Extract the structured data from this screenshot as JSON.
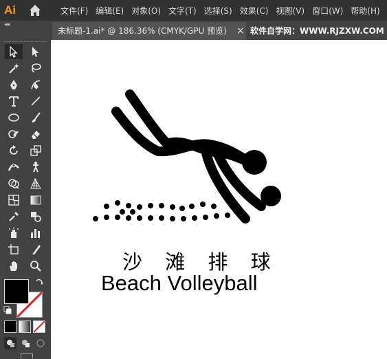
{
  "app": {
    "logo": "Ai"
  },
  "menu": [
    "文件(F)",
    "编辑(E)",
    "对象(O)",
    "文字(T)",
    "选择(S)",
    "效果(C)",
    "视图(V)",
    "窗口(W)",
    "帮助(H)"
  ],
  "tabs": {
    "collapse": "◂◂",
    "active": "未标题-1.ai* @ 186.36% (CMYK/GPU 预览)",
    "close": "×",
    "other": "软件自学网：WWW.RJZXW.COM"
  },
  "tools": [
    "selection-tool",
    "direct-selection-tool",
    "magic-wand-tool",
    "lasso-tool",
    "pen-tool",
    "curvature-tool",
    "type-tool",
    "line-segment-tool",
    "ellipse-tool",
    "paintbrush-tool",
    "shaper-tool",
    "eraser-tool",
    "rotate-tool",
    "scale-tool",
    "width-tool",
    "puppet-warp-tool",
    "shape-builder-tool",
    "perspective-grid-tool",
    "mesh-tool",
    "gradient-tool",
    "eyedropper-tool",
    "blend-tool",
    "symbol-sprayer-tool",
    "column-graph-tool",
    "artboard-tool",
    "slice-tool",
    "hand-tool",
    "zoom-tool"
  ],
  "colors": {
    "accent": "#ff9a00",
    "fill": "#000000",
    "stroke": "#ffffff",
    "none_slash": "#e02020"
  },
  "artwork": {
    "title_cn": "沙 滩 排 球",
    "title_en": "Beach Volleyball"
  }
}
